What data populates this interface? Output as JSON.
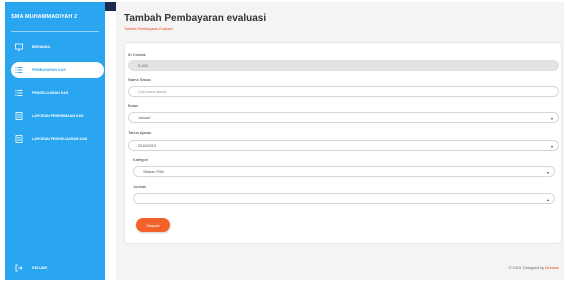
{
  "sidebar": {
    "title": "SMA MUHAMMADIYAH 2",
    "items": [
      {
        "label": "BERANDA",
        "icon": "monitor-icon"
      },
      {
        "label": "PEMBAYARAN KAS",
        "icon": "list-icon"
      },
      {
        "label": "PENGELUARAN KAS",
        "icon": "list-icon"
      },
      {
        "label": "LAPORAN PENERIMAAN KAS",
        "icon": "document-icon"
      },
      {
        "label": "LAPORAN PENGELUARAN KAS",
        "icon": "document-icon"
      }
    ],
    "logout_label": "KELUAR",
    "accent": "#2aa5f0"
  },
  "header": {
    "title": "Tambah Pembayaran evaluasi",
    "subtitle": "Tambah Pembayaran Evaluasi"
  },
  "form": {
    "id_label": "ID Kontak",
    "id_value": "E-004",
    "nama_label": "Nama Siswa",
    "nama_placeholder": "Cari nama siswa",
    "bulan_label": "Bulan",
    "bulan_value": "Januari",
    "tahun_label": "Tahun Ajaran",
    "tahun_value": "2018/2019",
    "kategori_label": "Kategori",
    "kategori_value": "Silakan Pilih",
    "jumlah_label": "Jumlah",
    "jumlah_value": "",
    "submit_label": "Simpan",
    "button_color": "#f4622b"
  },
  "footer": {
    "text": "© 2019. Designed by",
    "brand": "Muhtam"
  }
}
